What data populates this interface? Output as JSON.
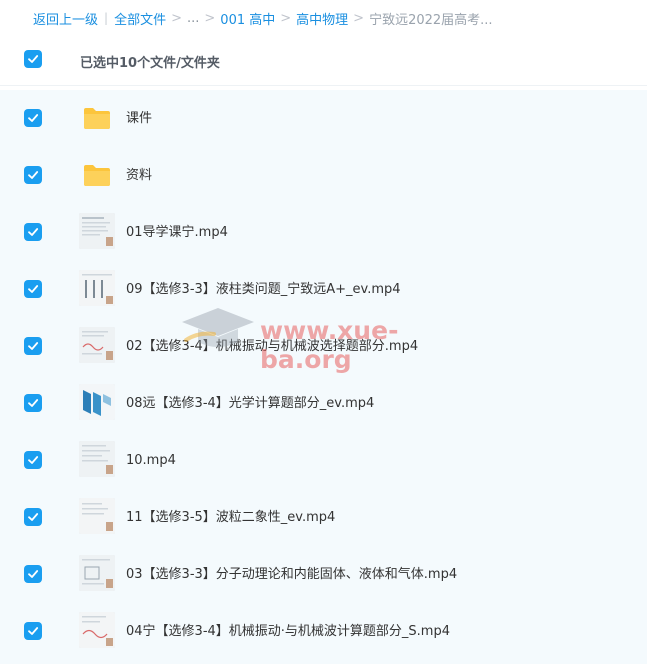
{
  "breadcrumb": {
    "back": "返回上一级",
    "all_files": "全部文件",
    "ellipsis": "...",
    "level1": "001 高中",
    "level2": "高中物理",
    "current": "宁致远2022届高考..."
  },
  "selection": {
    "summary": "已选中10个文件/文件夹"
  },
  "watermark": {
    "text": "www.xue-ba.org"
  },
  "colors": {
    "accent": "#1a9ef0",
    "link": "#1a8fe0",
    "folder": "#fcc53c",
    "list_bg": "#f4fafd"
  },
  "files": [
    {
      "name": "课件",
      "icon": "folder-icon",
      "checked": true
    },
    {
      "name": "资料",
      "icon": "folder-icon",
      "checked": true
    },
    {
      "name": "01导学课宁.mp4",
      "icon": "video-thumbnail",
      "checked": true
    },
    {
      "name": "09【选修3-3】液柱类问题_宁致远A+_ev.mp4",
      "icon": "video-thumbnail",
      "checked": true
    },
    {
      "name": "02【选修3-4】机械振动与机械波选择题部分.mp4",
      "icon": "video-thumbnail",
      "checked": true
    },
    {
      "name": "08远【选修3-4】光学计算题部分_ev.mp4",
      "icon": "video-thumbnail",
      "checked": true
    },
    {
      "name": "10.mp4",
      "icon": "video-thumbnail",
      "checked": true
    },
    {
      "name": "11【选修3-5】波粒二象性_ev.mp4",
      "icon": "video-thumbnail",
      "checked": true
    },
    {
      "name": "03【选修3-3】分子动理论和内能固体、液体和气体.mp4",
      "icon": "video-thumbnail",
      "checked": true
    },
    {
      "name": "04宁【选修3-4】机械振动·与机械波计算题部分_S.mp4",
      "icon": "video-thumbnail",
      "checked": true
    }
  ]
}
